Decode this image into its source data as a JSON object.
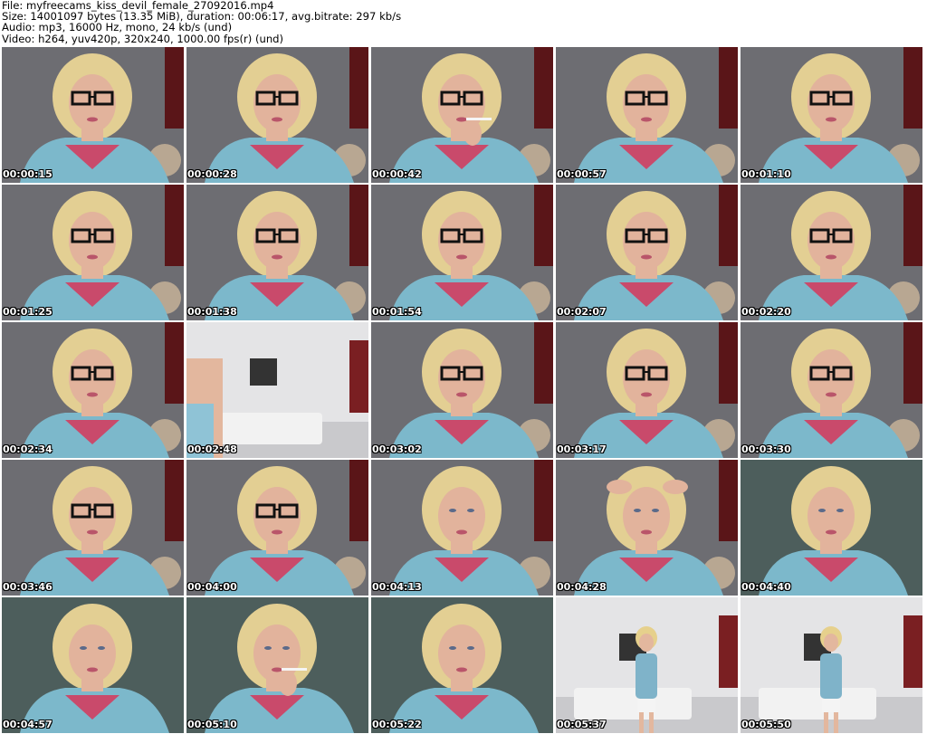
{
  "header": {
    "file": "File: myfreecams_kiss_devil_female_27092016.mp4",
    "size": "Size: 14001097 bytes (13.35 MiB), duration: 00:06:17, avg.bitrate: 297 kb/s",
    "audio": "Audio: mp3, 16000 Hz, mono, 24 kb/s (und)",
    "video": "Video: h264, yuv420p, 320x240, 1000.00 fps(r) (und)"
  },
  "thumbnails": [
    {
      "time": "00:00:15",
      "scene": "glasses"
    },
    {
      "time": "00:00:28",
      "scene": "glasses"
    },
    {
      "time": "00:00:42",
      "scene": "glasses-smoking"
    },
    {
      "time": "00:00:57",
      "scene": "glasses-gesture"
    },
    {
      "time": "00:01:10",
      "scene": "glasses"
    },
    {
      "time": "00:01:25",
      "scene": "glasses"
    },
    {
      "time": "00:01:38",
      "scene": "glasses-turned"
    },
    {
      "time": "00:01:54",
      "scene": "glasses"
    },
    {
      "time": "00:02:07",
      "scene": "glasses-head-down"
    },
    {
      "time": "00:02:20",
      "scene": "glasses"
    },
    {
      "time": "00:02:34",
      "scene": "glasses"
    },
    {
      "time": "00:02:48",
      "scene": "room"
    },
    {
      "time": "00:03:02",
      "scene": "glasses"
    },
    {
      "time": "00:03:17",
      "scene": "glasses"
    },
    {
      "time": "00:03:30",
      "scene": "glasses"
    },
    {
      "time": "00:03:46",
      "scene": "glasses"
    },
    {
      "time": "00:04:00",
      "scene": "glasses-hand-hair"
    },
    {
      "time": "00:04:13",
      "scene": "no-glasses"
    },
    {
      "time": "00:04:28",
      "scene": "hands-on-head"
    },
    {
      "time": "00:04:40",
      "scene": "no-glasses-teal"
    },
    {
      "time": "00:04:57",
      "scene": "no-glasses-teal"
    },
    {
      "time": "00:05:10",
      "scene": "smoking-teal"
    },
    {
      "time": "00:05:22",
      "scene": "no-glasses-teal"
    },
    {
      "time": "00:05:37",
      "scene": "standing-room"
    },
    {
      "time": "00:05:50",
      "scene": "standing-room"
    }
  ]
}
